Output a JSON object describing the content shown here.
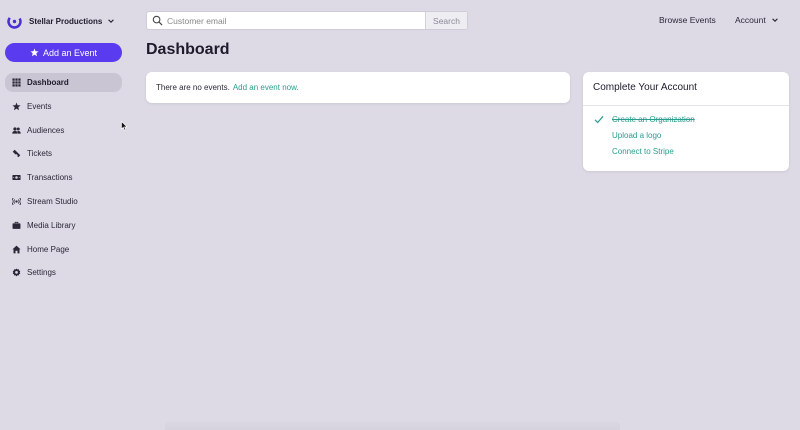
{
  "org": {
    "name": "Stellar Productions"
  },
  "sidebar": {
    "add_event_label": "Add an Event",
    "items": [
      {
        "label": "Dashboard",
        "icon": "grid-icon",
        "active": true
      },
      {
        "label": "Events",
        "icon": "star-icon"
      },
      {
        "label": "Audiences",
        "icon": "people-icon"
      },
      {
        "label": "Tickets",
        "icon": "ticket-icon"
      },
      {
        "label": "Transactions",
        "icon": "money-icon"
      },
      {
        "label": "Stream Studio",
        "icon": "broadcast-icon"
      },
      {
        "label": "Media Library",
        "icon": "briefcase-icon"
      },
      {
        "label": "Home Page",
        "icon": "home-icon"
      },
      {
        "label": "Settings",
        "icon": "gear-icon"
      }
    ]
  },
  "header": {
    "search_placeholder": "Customer email",
    "search_button": "Search",
    "browse_events": "Browse Events",
    "account": "Account"
  },
  "main": {
    "title": "Dashboard",
    "events": {
      "empty_text": "There are no events.",
      "add_link": "Add an event now."
    }
  },
  "complete_account": {
    "title": "Complete Your Account",
    "steps": [
      {
        "label": "Create an Organization",
        "done": true
      },
      {
        "label": "Upload a logo",
        "done": false
      },
      {
        "label": "Connect to Stripe",
        "done": false
      }
    ]
  },
  "colors": {
    "background": "#dddae5",
    "accent": "#5b3bf0",
    "link": "#2a9d8f",
    "active_nav": "#c9c5d2"
  }
}
